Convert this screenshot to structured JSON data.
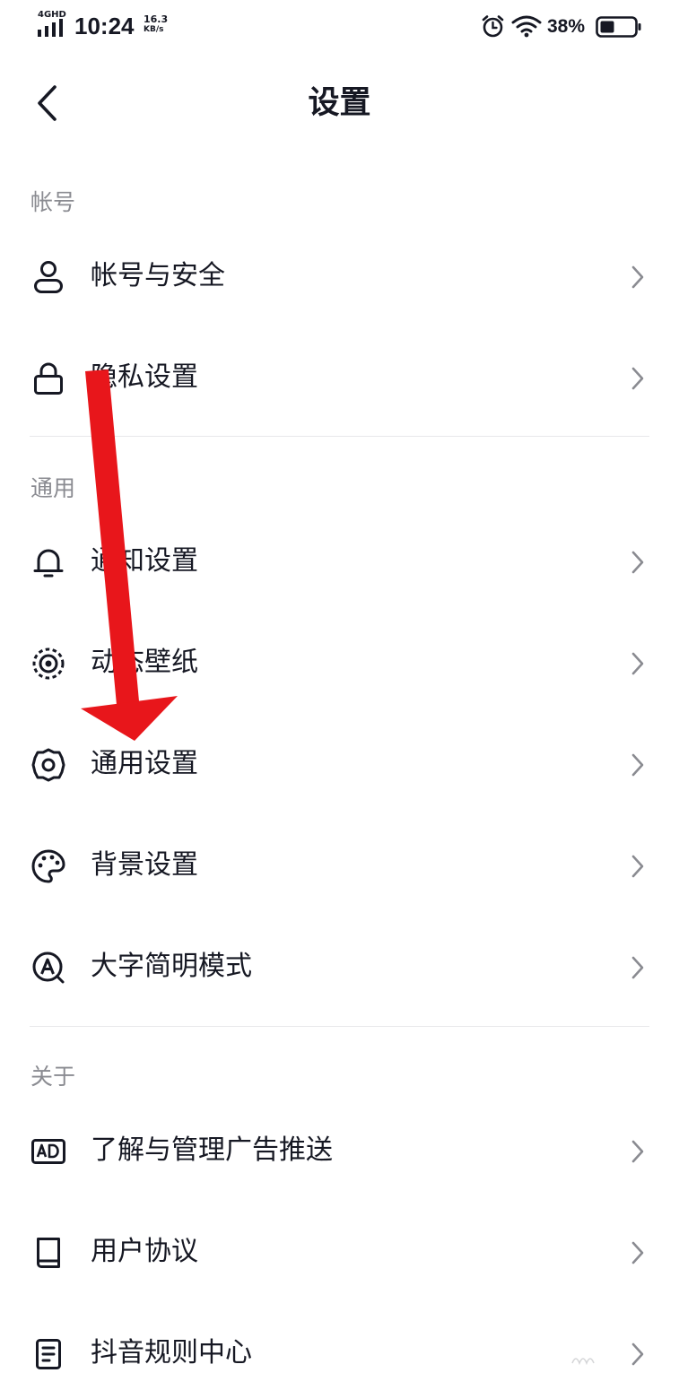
{
  "status_bar": {
    "network": "4GHD",
    "time": "10:24",
    "speed_value": "16.3",
    "speed_unit": "KB/s",
    "battery": "38%",
    "icons": [
      "signal-icon",
      "alarm-icon",
      "wifi-icon",
      "battery-icon"
    ]
  },
  "header": {
    "title": "设置",
    "back_icon": "back-arrow-icon"
  },
  "sections": [
    {
      "title": "帐号",
      "items": [
        {
          "label": "帐号与安全",
          "icon": "user-icon"
        },
        {
          "label": "隐私设置",
          "icon": "lock-icon"
        }
      ]
    },
    {
      "title": "通用",
      "items": [
        {
          "label": "通知设置",
          "icon": "bell-icon"
        },
        {
          "label": "动态壁纸",
          "icon": "live-wallpaper-icon"
        },
        {
          "label": "通用设置",
          "icon": "gear-icon"
        },
        {
          "label": "背景设置",
          "icon": "palette-icon"
        },
        {
          "label": "大字简明模式",
          "icon": "large-font-icon"
        }
      ]
    },
    {
      "title": "关于",
      "items": [
        {
          "label": "了解与管理广告推送",
          "icon": "ad-icon"
        },
        {
          "label": "用户协议",
          "icon": "book-icon"
        },
        {
          "label": "抖音规则中心",
          "icon": "document-icon"
        }
      ]
    }
  ],
  "colors": {
    "text": "#161823",
    "section_title": "#8a8b91",
    "divider": "#e8e8ea",
    "chevron": "#8a8b91",
    "annotation": "#e8161b"
  }
}
